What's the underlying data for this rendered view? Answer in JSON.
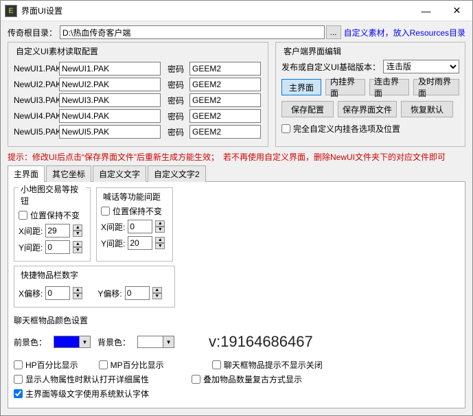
{
  "window": {
    "title": "界面UI设置"
  },
  "root": {
    "label": "传奇根目录：",
    "path": "D:\\热血传奇客户端",
    "dots": "...",
    "hint": "自定义素材，放入Resources目录"
  },
  "leftBox": {
    "title": "自定义UI素材读取配置",
    "pwLabel": "密码",
    "rows": [
      {
        "label": "NewUI1.PAK",
        "file": "NewUI1.PAK",
        "pw": "GEEM2"
      },
      {
        "label": "NewUI2.PAK",
        "file": "NewUI2.PAK",
        "pw": "GEEM2"
      },
      {
        "label": "NewUI3.PAK",
        "file": "NewUI3.PAK",
        "pw": "GEEM2"
      },
      {
        "label": "NewUI4.PAK",
        "file": "NewUI4.PAK",
        "pw": "GEEM2"
      },
      {
        "label": "NewUI5.PAK",
        "file": "NewUI5.PAK",
        "pw": "GEEM2"
      }
    ]
  },
  "rightBox": {
    "title": "客户端界面编辑",
    "selLabel": "发布或自定义UI基础版本：",
    "selValue": "连击版",
    "btns1": [
      "主界面",
      "内挂界面",
      "连击界面",
      "及时雨界面"
    ],
    "btns2": [
      "保存配置",
      "保存界面文件",
      "恢复默认"
    ],
    "chk": "完全自定义内挂各选项及位置"
  },
  "hint": {
    "p1": "提示：",
    "p2": "修改UI后点击“保存界面文件”后重新生成方能生效；　若不再使用自定义界面，删除NewUI文件夹下的对应文件即可"
  },
  "tabs": [
    "主界面",
    "其它坐标",
    "自定义文字",
    "自定义文字2"
  ],
  "groupA": {
    "title": "小地图交易等按钮",
    "keep": "位置保持不变",
    "xLabel": "X间距:",
    "xVal": "29",
    "yLabel": "Y间距:",
    "yVal": "0"
  },
  "groupB": {
    "title": "喊话等功能间距",
    "keep": "位置保持不变",
    "xLabel": "X间距:",
    "xVal": "0",
    "yLabel": "Y间距:",
    "yVal": "20"
  },
  "groupC": {
    "title": "快捷物品栏数字",
    "xLabel": "X偏移:",
    "xVal": "0",
    "yLabel": "Y偏移:",
    "yVal": "0"
  },
  "colors": {
    "title": "聊天框物品颜色设置",
    "fgLabel": "前景色：",
    "fg": "#0000ff",
    "bgLabel": "背景色：",
    "bg": "#ffffff"
  },
  "watermark": "v:19164686467",
  "checks": {
    "r1a": "HP百分比显示",
    "r1b": "MP百分比显示",
    "r1c": "聊天框物品提示不显示关闭",
    "r2a": "显示人物属性时默认打开详细属性",
    "r2b": "叠加物品数量复古方式显示",
    "r3a": "主界面等级文字使用系统默认字体"
  }
}
